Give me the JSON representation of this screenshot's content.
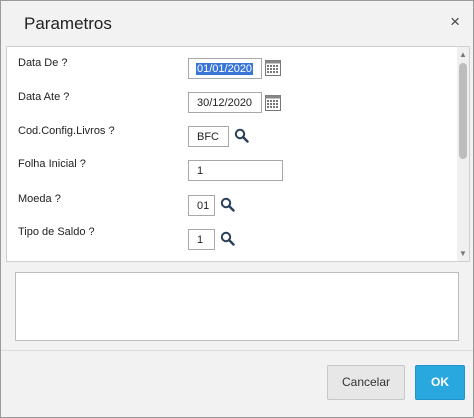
{
  "dialog": {
    "title": "Parametros",
    "close_symbol": "×",
    "fields": [
      {
        "label": "Data De ?",
        "value": "01/01/2020",
        "icon": "calendar-icon"
      },
      {
        "label": "Data Ate ?",
        "value": "30/12/2020",
        "icon": "calendar-icon"
      },
      {
        "label": "Cod.Config.Livros ?",
        "value": "BFC",
        "icon": "search-icon"
      },
      {
        "label": "Folha Inicial ?",
        "value": "1"
      },
      {
        "label": "Moeda ?",
        "value": "01",
        "icon": "search-icon"
      },
      {
        "label": "Tipo de Saldo ?",
        "value": "1",
        "icon": "search-icon"
      }
    ],
    "scroll_up": "▲",
    "scroll_down": "▼",
    "buttons": {
      "cancel": "Cancelar",
      "ok": "OK"
    }
  },
  "colors": {
    "accent": "#29a8e0",
    "selection": "#3875d7",
    "background": "#f2f2f2"
  }
}
